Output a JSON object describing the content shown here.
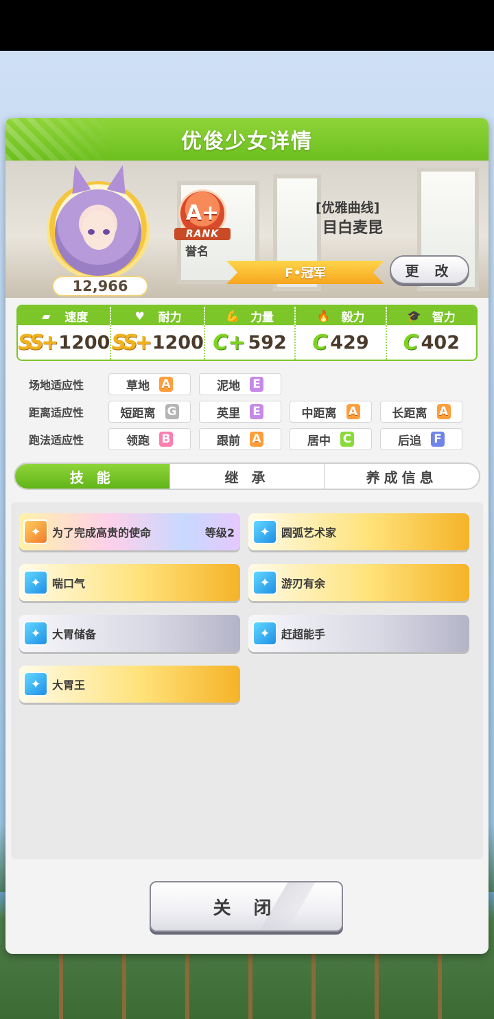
{
  "dialog": {
    "title": "优俊少女详情"
  },
  "profile": {
    "fans": "12,966",
    "rank_grade": "A+",
    "rank_ribbon": "RANK",
    "rank_label": "誉名",
    "epithet": "[优雅曲线]",
    "name": "目白麦昆",
    "title": "F•冠军",
    "change_label": "更 改"
  },
  "stats": [
    {
      "label": "速度",
      "icon": "shoe-icon",
      "glyph": "▰",
      "grade": "SS+",
      "value": "1200"
    },
    {
      "label": "耐力",
      "icon": "heart-icon",
      "glyph": "♥",
      "grade": "SS+",
      "value": "1200"
    },
    {
      "label": "力量",
      "icon": "muscle-icon",
      "glyph": "💪",
      "grade": "C+",
      "value": "592"
    },
    {
      "label": "毅力",
      "icon": "flame-icon",
      "glyph": "🔥",
      "grade": "C",
      "value": "429"
    },
    {
      "label": "智力",
      "icon": "graduation-cap-icon",
      "glyph": "🎓",
      "grade": "C",
      "value": "402"
    }
  ],
  "aptitude": {
    "track": {
      "label": "场地适应性",
      "items": [
        {
          "name": "草地",
          "grade": "A"
        },
        {
          "name": "泥地",
          "grade": "E"
        }
      ]
    },
    "distance": {
      "label": "距离适应性",
      "items": [
        {
          "name": "短距离",
          "grade": "G"
        },
        {
          "name": "英里",
          "grade": "E"
        },
        {
          "name": "中距离",
          "grade": "A"
        },
        {
          "name": "长距离",
          "grade": "A"
        }
      ]
    },
    "style": {
      "label": "跑法适应性",
      "items": [
        {
          "name": "领跑",
          "grade": "B"
        },
        {
          "name": "跟前",
          "grade": "A"
        },
        {
          "name": "居中",
          "grade": "C"
        },
        {
          "name": "后追",
          "grade": "F"
        }
      ]
    }
  },
  "tabs": [
    {
      "label": "技 能"
    },
    {
      "label": "继 承"
    },
    {
      "label": "养成信息"
    }
  ],
  "skills": [
    {
      "name": "为了完成高贵的使命",
      "level": "等级2",
      "type": "rainbow"
    },
    {
      "name": "圆弧艺术家",
      "level": "",
      "type": "gold"
    },
    {
      "name": "喘口气",
      "level": "",
      "type": "gold"
    },
    {
      "name": "游刃有余",
      "level": "",
      "type": "gold"
    },
    {
      "name": "大胃储备",
      "level": "",
      "type": "gray"
    },
    {
      "name": "赶超能手",
      "level": "",
      "type": "gray"
    },
    {
      "name": "大胃王",
      "level": "",
      "type": "gold"
    }
  ],
  "footer": {
    "close_label": "关 闭"
  },
  "colors": {
    "accent_green": "#7cc62a",
    "gold": "#f5b328"
  }
}
